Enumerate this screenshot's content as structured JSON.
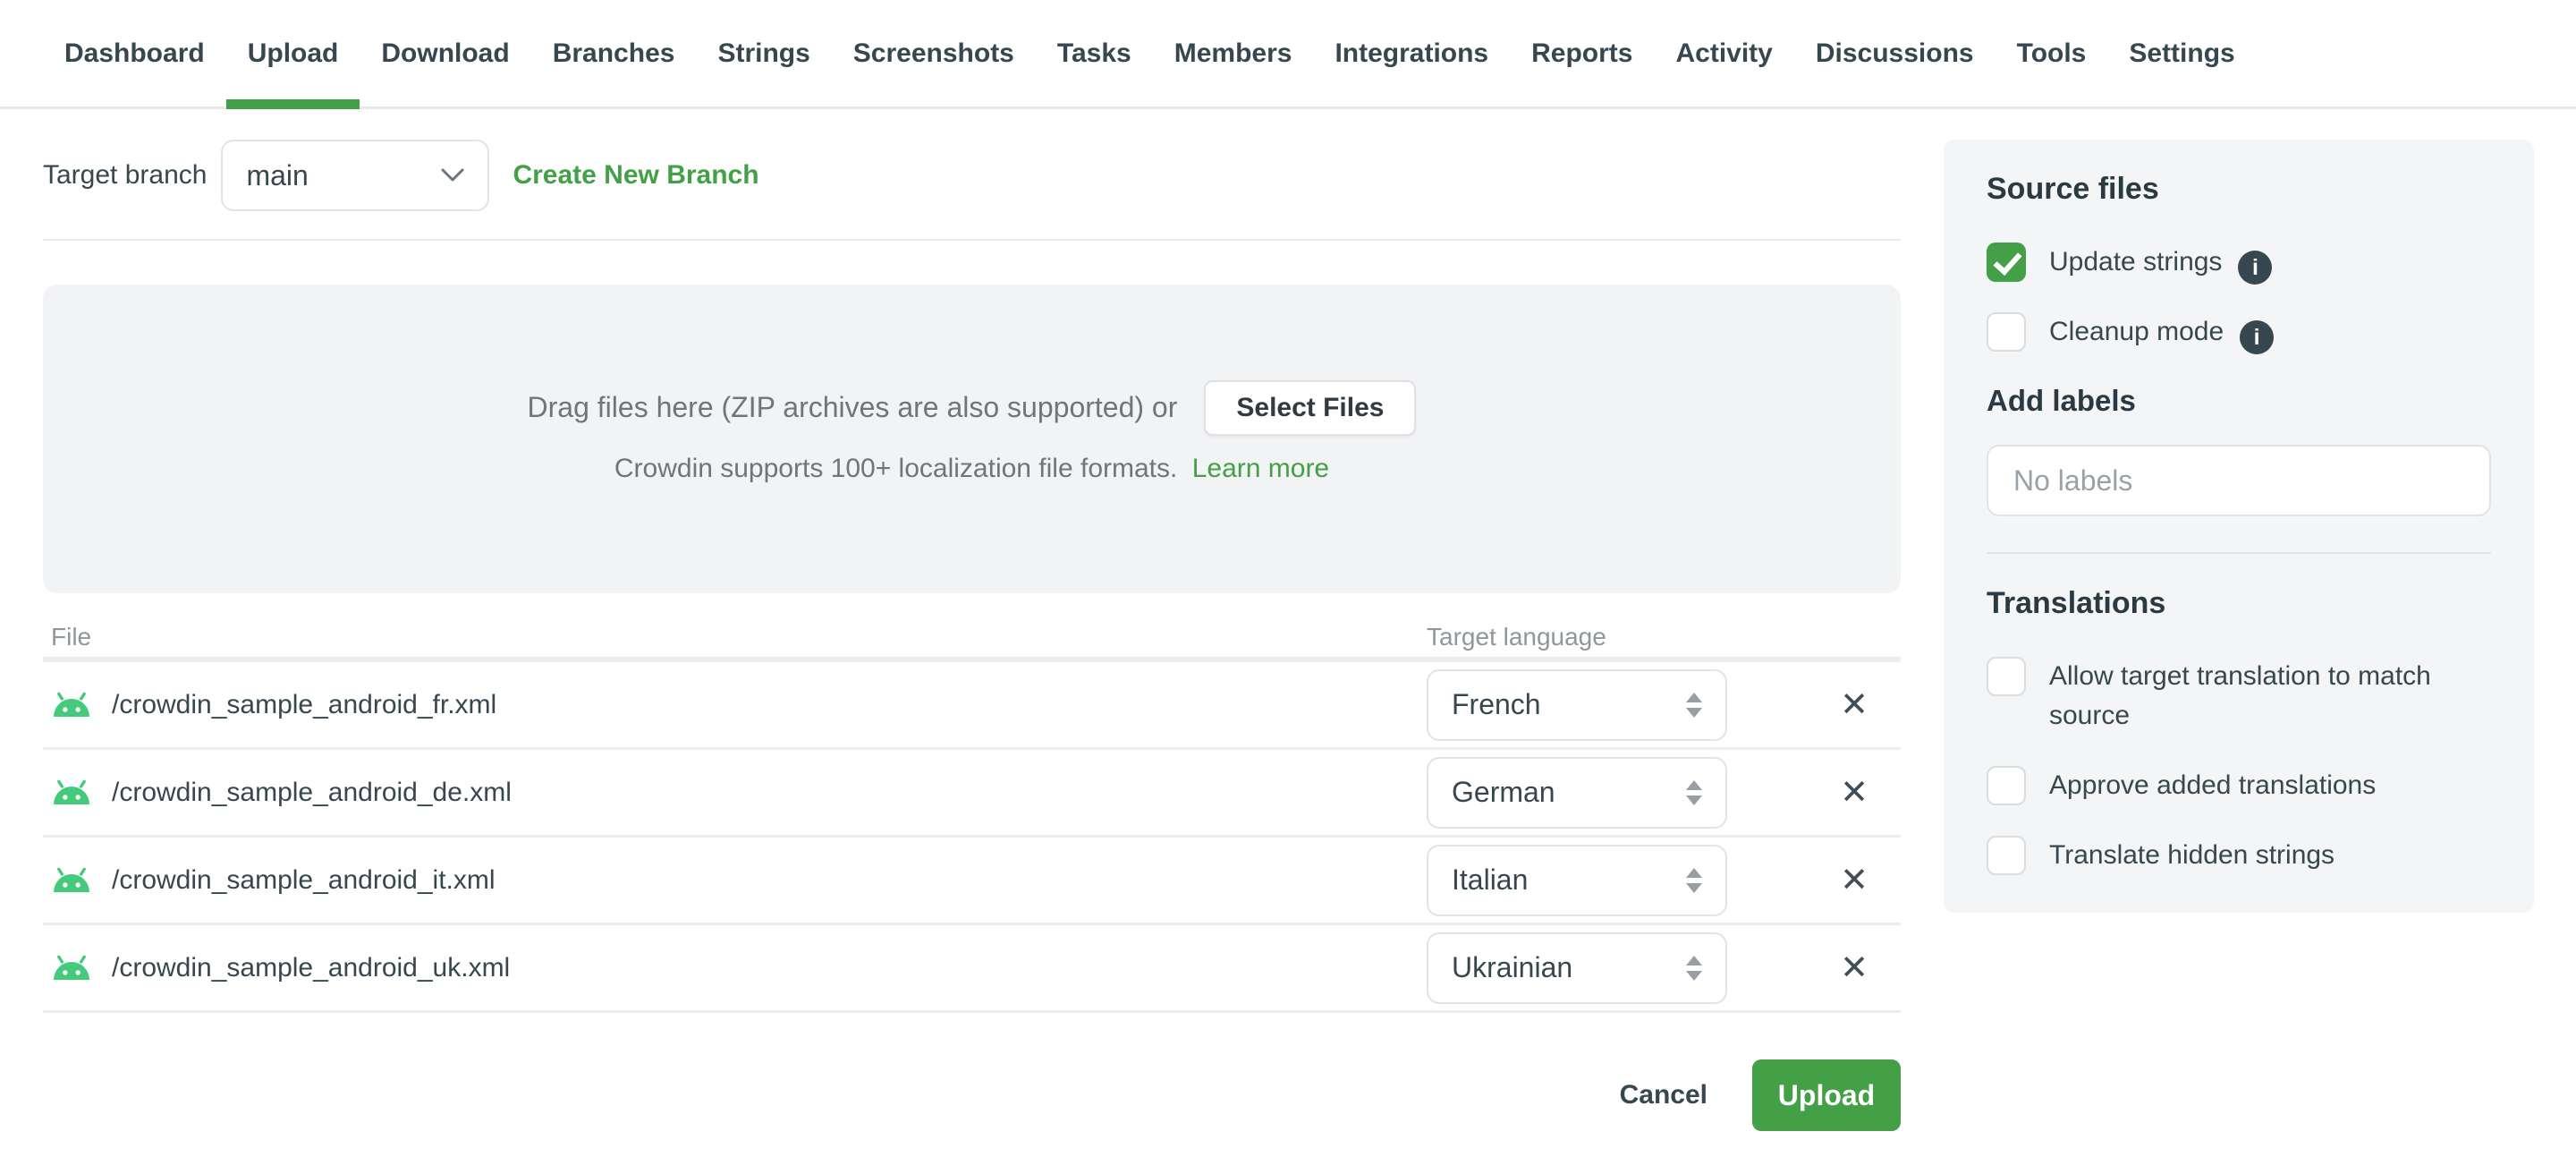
{
  "nav": {
    "items": [
      {
        "label": "Dashboard",
        "active": false
      },
      {
        "label": "Upload",
        "active": true
      },
      {
        "label": "Download",
        "active": false
      },
      {
        "label": "Branches",
        "active": false
      },
      {
        "label": "Strings",
        "active": false
      },
      {
        "label": "Screenshots",
        "active": false
      },
      {
        "label": "Tasks",
        "active": false
      },
      {
        "label": "Members",
        "active": false
      },
      {
        "label": "Integrations",
        "active": false
      },
      {
        "label": "Reports",
        "active": false
      },
      {
        "label": "Activity",
        "active": false
      },
      {
        "label": "Discussions",
        "active": false
      },
      {
        "label": "Tools",
        "active": false
      },
      {
        "label": "Settings",
        "active": false
      }
    ]
  },
  "branch_bar": {
    "label": "Target branch",
    "selected_branch": "main",
    "create_link": "Create New Branch"
  },
  "dropzone": {
    "drag_text": "Drag files here (ZIP archives are also supported) or",
    "select_button": "Select Files",
    "formats_text": "Crowdin supports 100+ localization file formats.",
    "learn_more": "Learn more"
  },
  "files_table": {
    "columns": {
      "file": "File",
      "target_language": "Target language"
    },
    "rows": [
      {
        "file": "/crowdin_sample_android_fr.xml",
        "language": "French"
      },
      {
        "file": "/crowdin_sample_android_de.xml",
        "language": "German"
      },
      {
        "file": "/crowdin_sample_android_it.xml",
        "language": "Italian"
      },
      {
        "file": "/crowdin_sample_android_uk.xml",
        "language": "Ukrainian"
      }
    ]
  },
  "footer": {
    "cancel_label": "Cancel",
    "upload_label": "Upload"
  },
  "sidebar": {
    "source_files": {
      "title": "Source files",
      "options": [
        {
          "label": "Update strings",
          "checked": true,
          "has_info": true
        },
        {
          "label": "Cleanup mode",
          "checked": false,
          "has_info": true
        }
      ]
    },
    "labels": {
      "title": "Add labels",
      "placeholder": "No labels"
    },
    "translations": {
      "title": "Translations",
      "options": [
        {
          "label": "Allow target translation to match source",
          "checked": false
        },
        {
          "label": "Approve added translations",
          "checked": false
        },
        {
          "label": "Translate hidden strings",
          "checked": false
        }
      ]
    }
  },
  "icons": {
    "close": "✕",
    "info": "i"
  },
  "colors": {
    "accent_green": "#43a047",
    "android_green": "#44ca7b",
    "panel_bg": "#f4f5f6",
    "text_dark": "#37474f"
  }
}
